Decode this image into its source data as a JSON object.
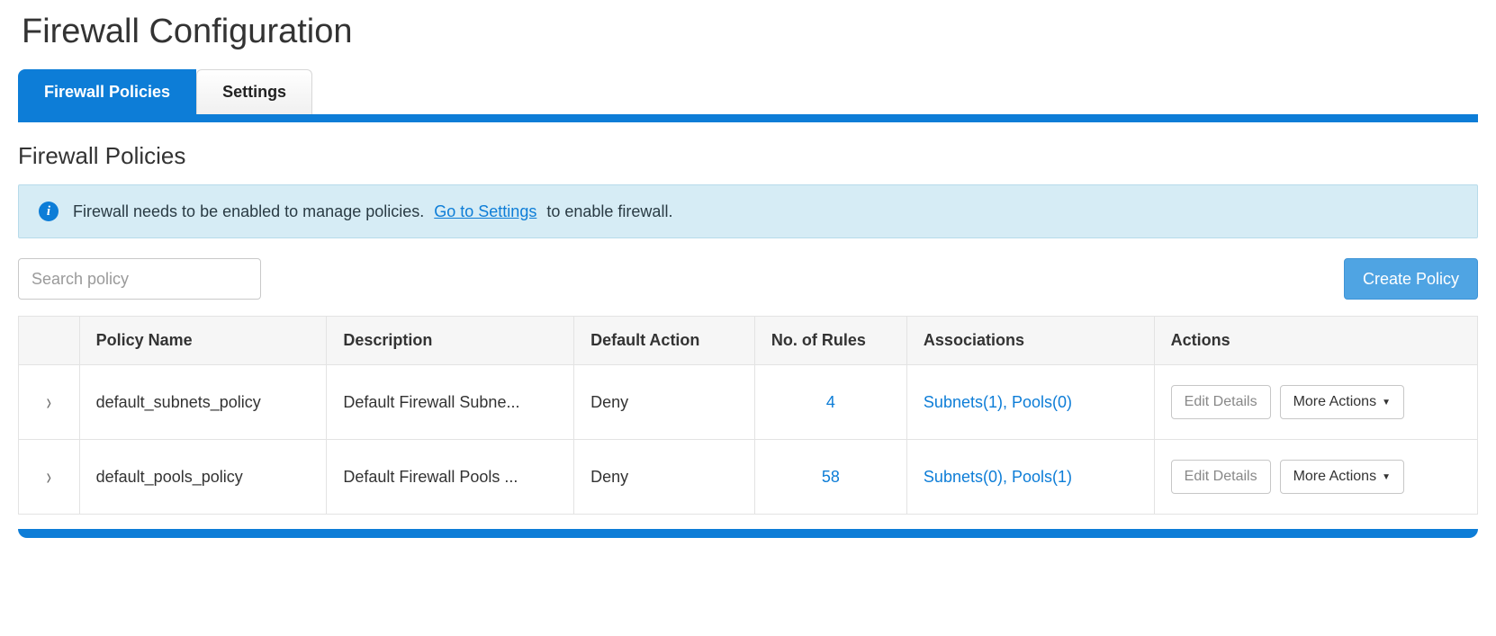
{
  "page": {
    "title": "Firewall Configuration"
  },
  "tabs": {
    "policies": "Firewall Policies",
    "settings": "Settings"
  },
  "subHeading": "Firewall Policies",
  "info": {
    "text_before": "Firewall needs to be enabled to manage policies.",
    "link": "Go to Settings",
    "text_after": "to enable firewall.",
    "icon_glyph": "i"
  },
  "search": {
    "placeholder": "Search policy",
    "value": ""
  },
  "buttons": {
    "create": "Create Policy",
    "edit": "Edit Details",
    "more": "More Actions"
  },
  "table": {
    "headers": {
      "name": "Policy Name",
      "desc": "Description",
      "defaultAction": "Default Action",
      "rules": "No. of Rules",
      "assoc": "Associations",
      "actions": "Actions"
    },
    "rows": [
      {
        "name": "default_subnets_policy",
        "desc": "Default Firewall Subne...",
        "defaultAction": "Deny",
        "rules": "4",
        "assoc": "Subnets(1), Pools(0)"
      },
      {
        "name": "default_pools_policy",
        "desc": "Default Firewall Pools ...",
        "defaultAction": "Deny",
        "rules": "58",
        "assoc": "Subnets(0), Pools(1)"
      }
    ]
  },
  "glyphs": {
    "chevron_right": "›",
    "caret_down": "▼"
  }
}
